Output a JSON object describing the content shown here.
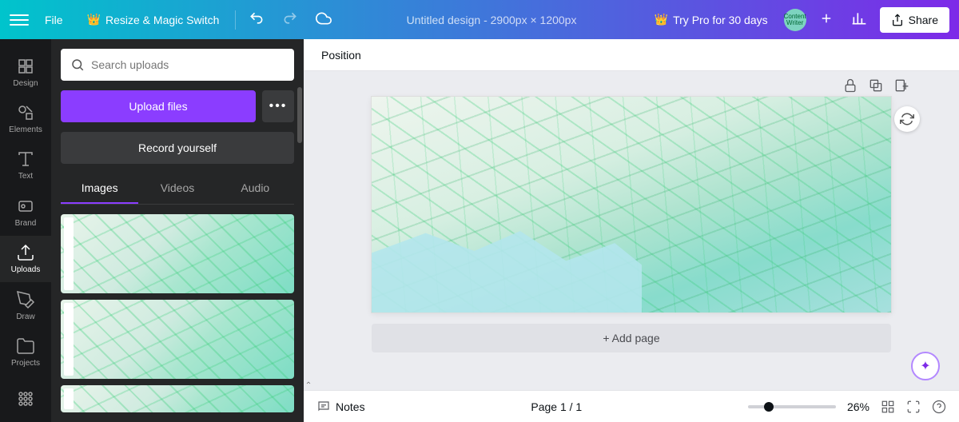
{
  "topbar": {
    "file_label": "File",
    "resize_label": "Resize & Magic Switch",
    "doc_title": "Untitled design - 2900px × 1200px",
    "try_pro_label": "Try Pro for 30 days",
    "share_label": "Share",
    "avatar_text": "Content Writer"
  },
  "nav": {
    "items": [
      {
        "label": "Design"
      },
      {
        "label": "Elements"
      },
      {
        "label": "Text"
      },
      {
        "label": "Brand"
      },
      {
        "label": "Uploads"
      },
      {
        "label": "Draw"
      },
      {
        "label": "Projects"
      }
    ]
  },
  "panel": {
    "search_placeholder": "Search uploads",
    "upload_label": "Upload files",
    "record_label": "Record yourself",
    "tabs": [
      {
        "label": "Images"
      },
      {
        "label": "Videos"
      },
      {
        "label": "Audio"
      }
    ]
  },
  "canvas": {
    "position_label": "Position",
    "add_page_label": "+ Add page"
  },
  "bottom": {
    "notes_label": "Notes",
    "page_indicator": "Page 1 / 1",
    "zoom_label": "26%"
  }
}
